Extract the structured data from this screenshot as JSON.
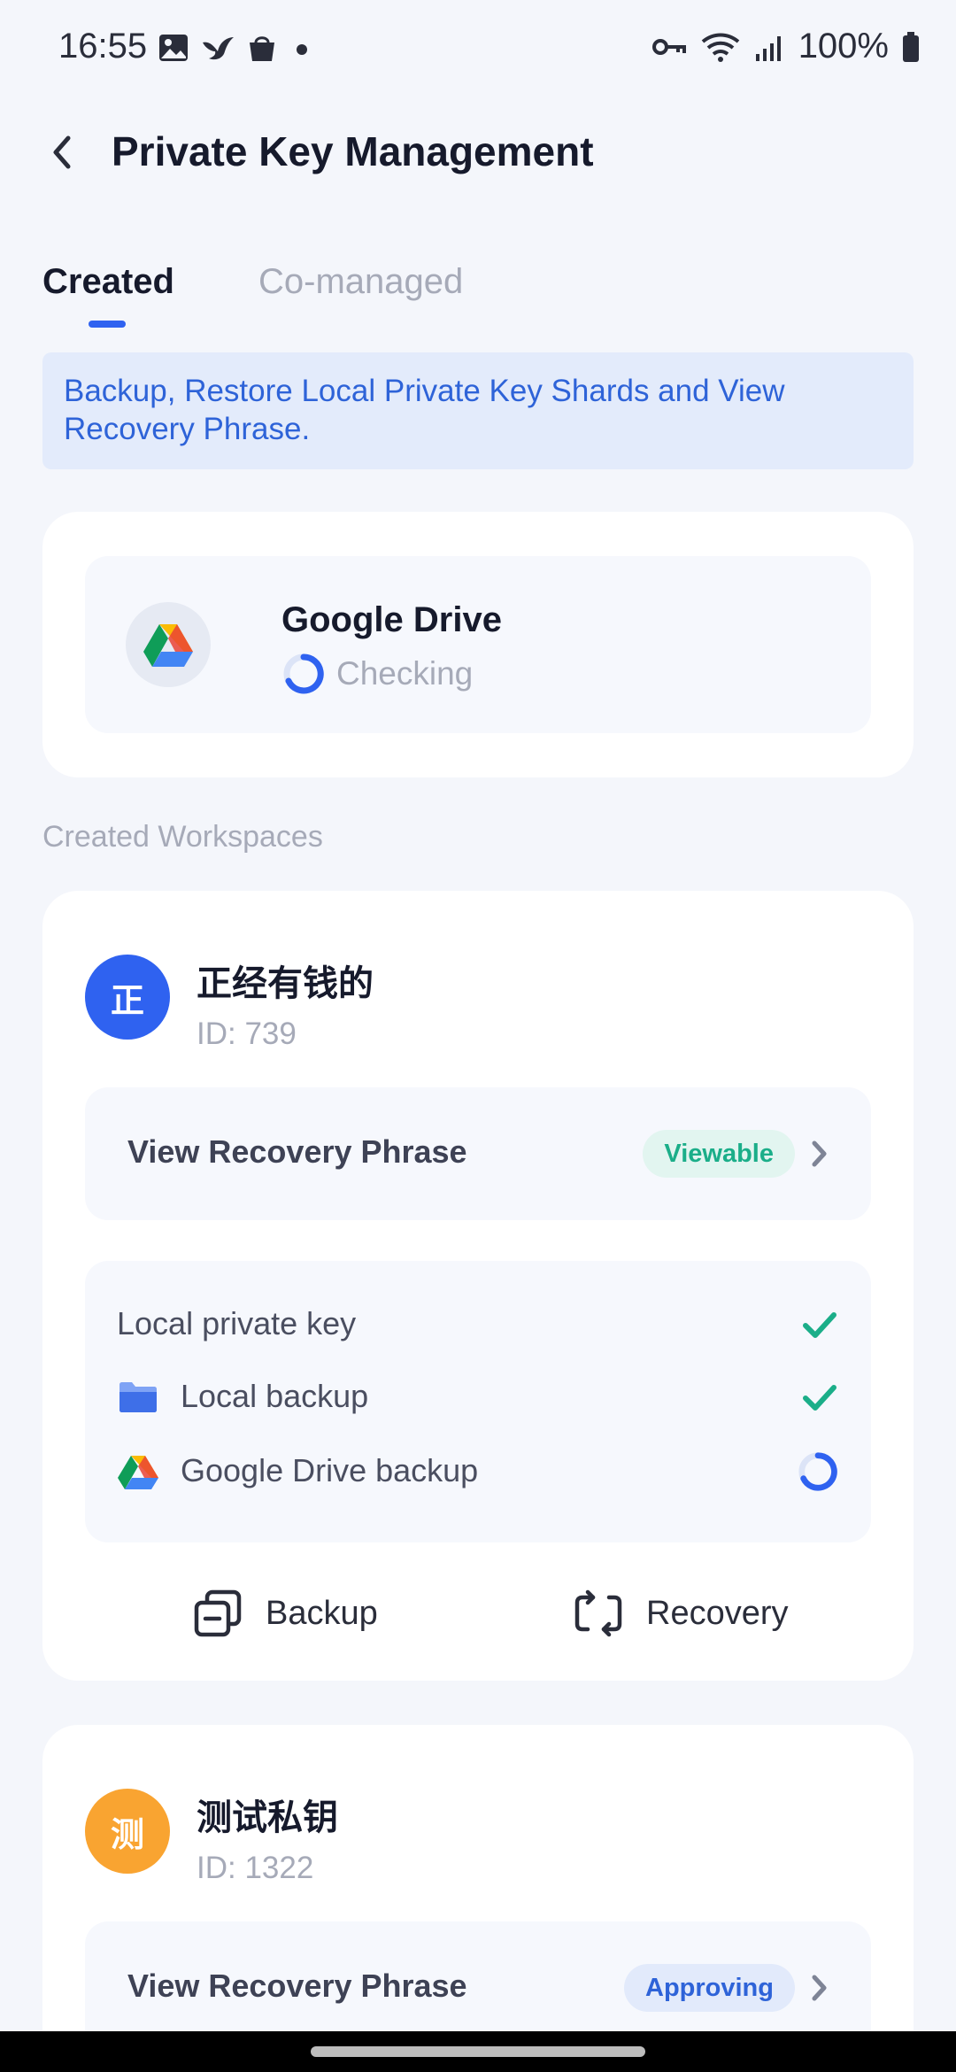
{
  "status_bar": {
    "time": "16:55",
    "battery": "100%",
    "icons_left": [
      "image-icon",
      "bird-icon",
      "bag-icon",
      "dot-icon"
    ],
    "icons_right": [
      "key-icon",
      "wifi-icon",
      "signal-icon",
      "battery-icon"
    ]
  },
  "header": {
    "title": "Private Key Management"
  },
  "tabs": [
    {
      "label": "Created",
      "active": true
    },
    {
      "label": "Co-managed",
      "active": false
    }
  ],
  "banner": {
    "text": "Backup, Restore Local Private Key Shards and View Recovery Phrase."
  },
  "drive": {
    "name": "Google Drive",
    "status": "Checking"
  },
  "section_label": "Created Workspaces",
  "workspaces": [
    {
      "avatar_letter": "正",
      "avatar_color": "#2F62F0",
      "name": "正经有钱的",
      "id": "ID: 739",
      "phrase_label": "View Recovery Phrase",
      "phrase_badge": "Viewable",
      "status": [
        {
          "label": "Local private key",
          "state": "done"
        },
        {
          "label": "Local backup",
          "state": "done"
        },
        {
          "label": "Google Drive backup",
          "state": "loading"
        }
      ],
      "actions": {
        "backup": "Backup",
        "recovery": "Recovery"
      }
    },
    {
      "avatar_letter": "测",
      "avatar_color": "#F9A431",
      "name": "测试私钥",
      "id": "ID: 1322",
      "phrase_label": "View Recovery Phrase",
      "phrase_badge": "Approving"
    }
  ],
  "colors": {
    "accent": "#2F62F0",
    "success": "#1BAE89",
    "muted": "#A6AAB8"
  }
}
